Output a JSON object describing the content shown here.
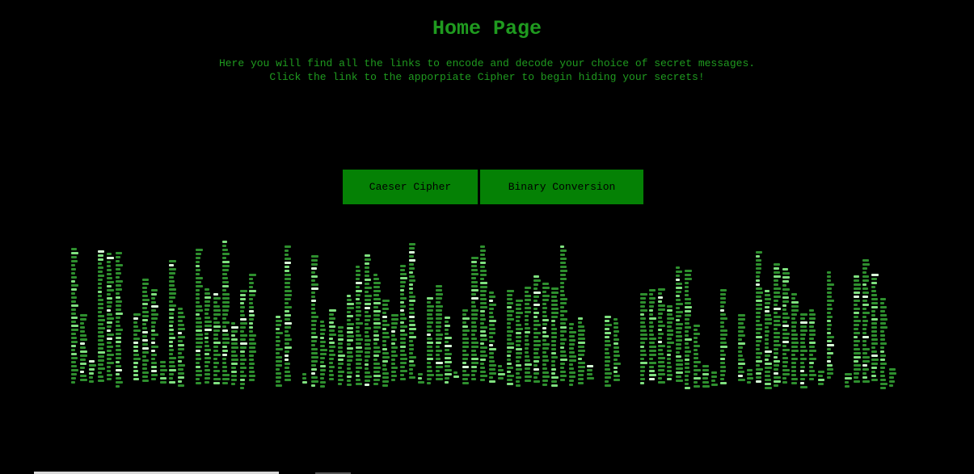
{
  "header": {
    "title": "Home Page"
  },
  "intro": {
    "line1": "Here you will find all the links to encode and decode your choice of secret messages.",
    "line2": "Click the link to the apporpiate Cipher to begin hiding your secrets!"
  },
  "nav": {
    "caesar_label": "Caeser Cipher",
    "binary_label": "Binary Conversion"
  },
  "colors": {
    "background": "#000000",
    "text_green": "#1f9a1f",
    "button_green": "#058105",
    "rain_green": "#2e8f2e"
  }
}
